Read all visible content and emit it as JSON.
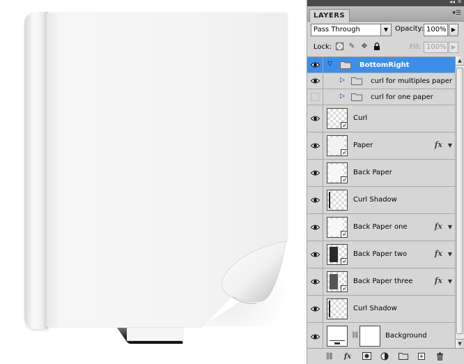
{
  "panel": {
    "tab_label": "LAYERS",
    "blend_mode": "Pass Through",
    "opacity_label": "Opacity:",
    "opacity_value": "100%",
    "lock_label": "Lock:",
    "fill_label": "Fill:",
    "fill_value": "100%"
  },
  "layers": [
    {
      "name": "BottomRight",
      "kind": "group",
      "selected": true,
      "visible": true
    },
    {
      "name": "curl for multiples paper",
      "kind": "subgroup",
      "visible": true
    },
    {
      "name": "curl for one paper",
      "kind": "subgroup",
      "visible": false
    },
    {
      "name": "Curl",
      "kind": "smart",
      "visible": true
    },
    {
      "name": "Paper",
      "kind": "smart",
      "visible": true,
      "fx": true
    },
    {
      "name": "Back Paper",
      "kind": "smart",
      "visible": true
    },
    {
      "name": "Curl Shadow",
      "kind": "layer",
      "visible": true
    },
    {
      "name": "Back Paper one",
      "kind": "smart",
      "visible": true,
      "fx": true
    },
    {
      "name": "Back Paper two",
      "kind": "smart",
      "visible": true,
      "fx": true
    },
    {
      "name": "Back Paper three",
      "kind": "smart",
      "visible": true,
      "fx": true
    },
    {
      "name": "Curl Shadow",
      "kind": "layer",
      "visible": true
    },
    {
      "name": "Background",
      "kind": "masked",
      "visible": true
    }
  ],
  "icons": {
    "fx": "fx",
    "eye": "eye-icon",
    "folder": "folder-icon"
  },
  "colors": {
    "selection": "#3d8ee8",
    "panel": "#d6d6d6"
  }
}
